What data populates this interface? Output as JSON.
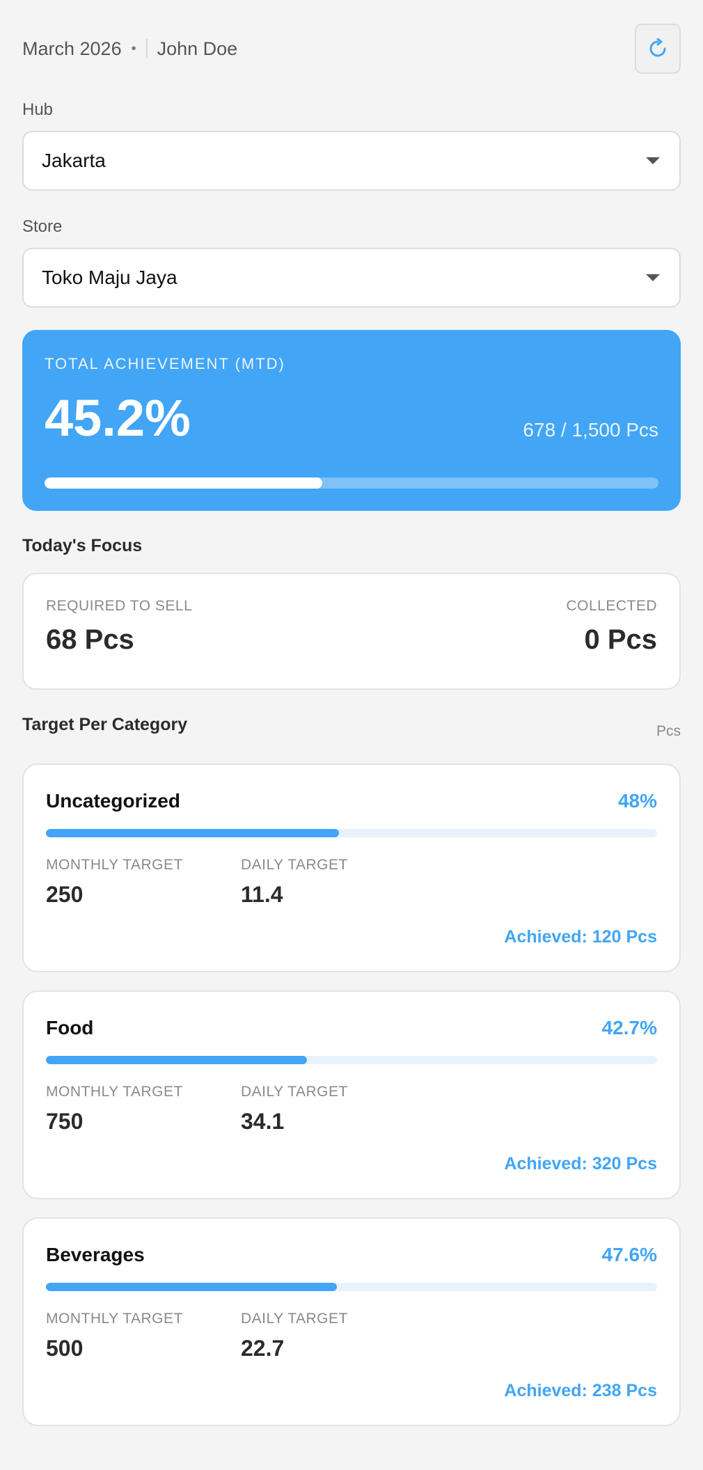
{
  "header": {
    "period": "March 2026",
    "separator": "•",
    "user": "John Doe"
  },
  "filters": {
    "hub": {
      "label": "Hub",
      "value": "Jakarta"
    },
    "store": {
      "label": "Store",
      "value": "Toko Maju Jaya"
    }
  },
  "achievement": {
    "title": "TOTAL ACHIEVEMENT (MTD)",
    "percent_label": "45.2%",
    "progress_fraction": 0.452,
    "count_label": "678 / 1,500 Pcs"
  },
  "focus": {
    "title": "Today's Focus",
    "required_label": "REQUIRED TO SELL",
    "required_value": "68 Pcs",
    "collected_label": "COLLECTED",
    "collected_value": "0 Pcs"
  },
  "categories_section": {
    "title": "Target Per Category",
    "unit": "Pcs",
    "monthly_label": "MONTHLY TARGET",
    "daily_label": "DAILY TARGET"
  },
  "categories": [
    {
      "name": "Uncategorized",
      "percent_label": "48%",
      "progress_fraction": 0.48,
      "monthly": "250",
      "daily": "11.4",
      "achieved": "Achieved: 120 Pcs"
    },
    {
      "name": "Food",
      "percent_label": "42.7%",
      "progress_fraction": 0.427,
      "monthly": "750",
      "daily": "34.1",
      "achieved": "Achieved: 320 Pcs"
    },
    {
      "name": "Beverages",
      "percent_label": "47.6%",
      "progress_fraction": 0.476,
      "monthly": "500",
      "daily": "22.7",
      "achieved": "Achieved: 238 Pcs"
    }
  ],
  "icons": {
    "refresh": "refresh-icon",
    "dropdown": "chevron-down-icon"
  },
  "colors": {
    "accent": "#42a5f5",
    "background": "#f4f4f5"
  }
}
